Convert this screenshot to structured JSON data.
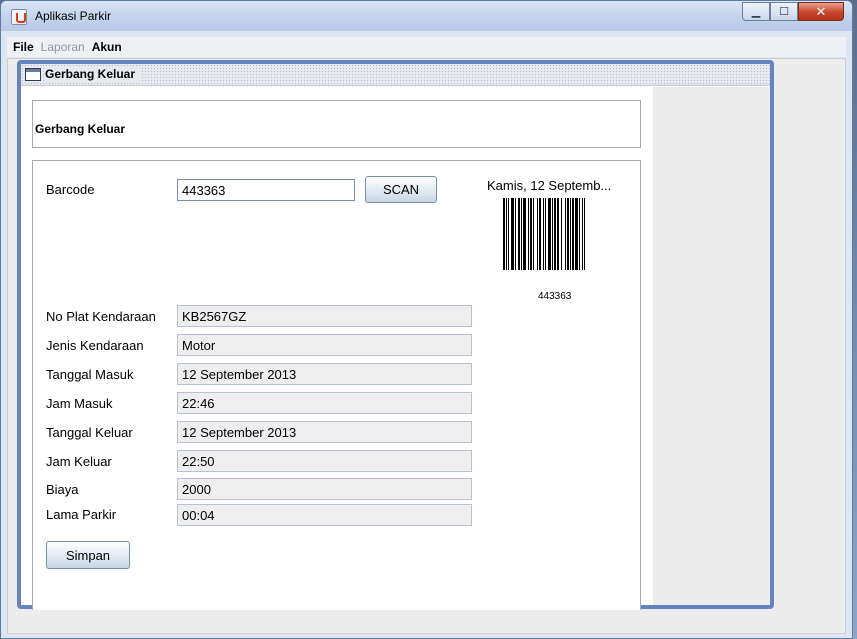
{
  "window": {
    "title": "Aplikasi Parkir"
  },
  "menu": [
    {
      "label": "File",
      "enabled": true
    },
    {
      "label": "Laporan",
      "enabled": false
    },
    {
      "label": "Akun",
      "enabled": true
    }
  ],
  "internal_frame": {
    "title": "Gerbang Keluar"
  },
  "header": {
    "title": "Gerbang Keluar"
  },
  "barcode": {
    "label": "Barcode",
    "value": "443363",
    "scan_button": "SCAN",
    "image_number": "443363",
    "date_text": "Kamis, 12 Septemb..."
  },
  "fields": [
    {
      "label": "No Plat Kendaraan",
      "value": "KB2567GZ"
    },
    {
      "label": "Jenis Kendaraan",
      "value": "Motor"
    },
    {
      "label": "Tanggal Masuk",
      "value": "12 September 2013"
    },
    {
      "label": "Jam Masuk",
      "value": "22:46"
    },
    {
      "label": "Tanggal Keluar",
      "value": "12 September 2013"
    },
    {
      "label": "Jam Keluar",
      "value": "22:50"
    },
    {
      "label": "Biaya",
      "value": "2000"
    },
    {
      "label": "Lama Parkir",
      "value": "00:04"
    }
  ],
  "save_button": "Simpan",
  "icons": {
    "app": "java-cup-icon",
    "frame": "window-icon"
  }
}
